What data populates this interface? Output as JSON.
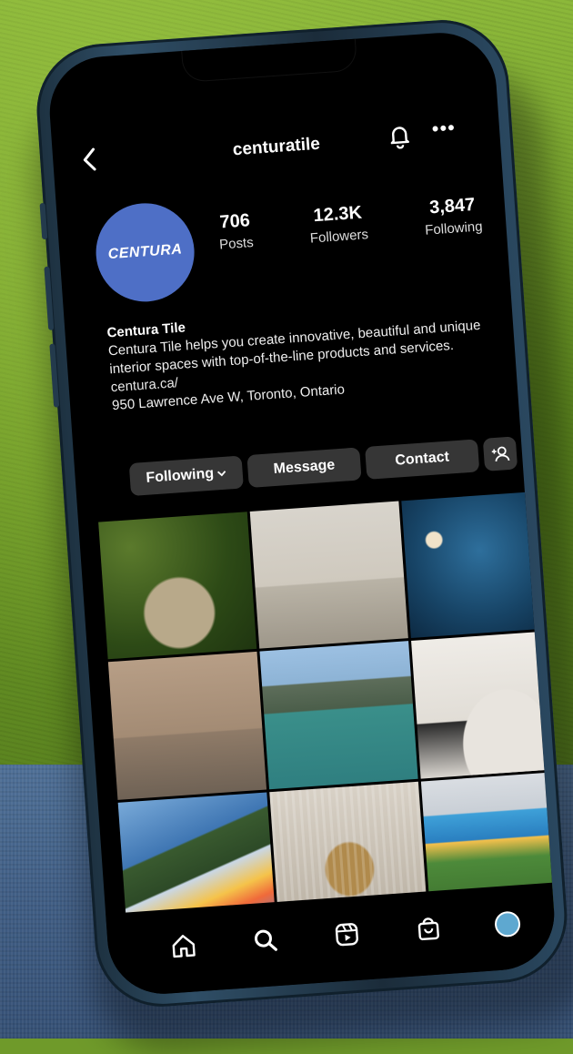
{
  "header": {
    "username": "centuratile",
    "back_icon": "chevron-left-icon",
    "bell_icon": "bell-icon",
    "more_icon": "more-horizontal-icon"
  },
  "profile": {
    "avatar_logo_text": "CENTURA",
    "avatar_color": "#4e6fc6",
    "stats": [
      {
        "value": "706",
        "label": "Posts"
      },
      {
        "value": "12.3K",
        "label": "Followers"
      },
      {
        "value": "3,847",
        "label": "Following"
      }
    ],
    "name": "Centura Tile",
    "bio": "Centura Tile helps you create innovative, beautiful and unique interior spaces with top-of-the-line products and services.",
    "link": "centura.ca/",
    "address": "950 Lawrence Ave W, Toronto, Ontario"
  },
  "actions": {
    "following_label": "Following",
    "message_label": "Message",
    "contact_label": "Contact",
    "add_person_icon": "add-person-icon"
  },
  "nav": {
    "items": [
      "home-icon",
      "search-icon",
      "reels-icon",
      "shop-icon",
      "profile-avatar"
    ]
  }
}
